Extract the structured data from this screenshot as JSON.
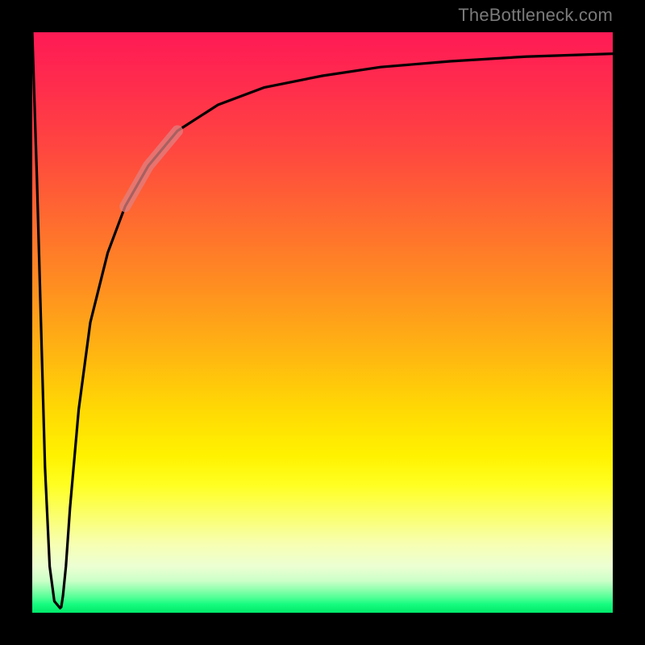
{
  "watermark": "TheBottleneck.com",
  "chart_data": {
    "type": "line",
    "title": "",
    "xlabel": "",
    "ylabel": "",
    "xlim": [
      0,
      100
    ],
    "ylim": [
      0,
      100
    ],
    "grid": false,
    "legend": false,
    "series": [
      {
        "name": "bottleneck-curve",
        "x": [
          0.0,
          0.8,
          1.5,
          2.2,
          3.0,
          3.8,
          4.8,
          5.0,
          5.3,
          5.8,
          6.5,
          8.0,
          10.0,
          13.0,
          16.0,
          20.0,
          25.0,
          32.0,
          40.0,
          50.0,
          60.0,
          72.0,
          85.0,
          100.0
        ],
        "y": [
          100.0,
          75.0,
          50.0,
          25.0,
          8.0,
          2.0,
          0.8,
          1.0,
          3.0,
          8.0,
          18.0,
          35.0,
          50.0,
          62.0,
          70.0,
          77.0,
          83.0,
          87.5,
          90.5,
          92.5,
          94.0,
          95.0,
          95.8,
          96.3
        ]
      },
      {
        "name": "highlight-segment",
        "x": [
          16.0,
          20.0,
          25.0
        ],
        "y": [
          70.0,
          77.0,
          83.0
        ]
      }
    ],
    "annotations": []
  }
}
